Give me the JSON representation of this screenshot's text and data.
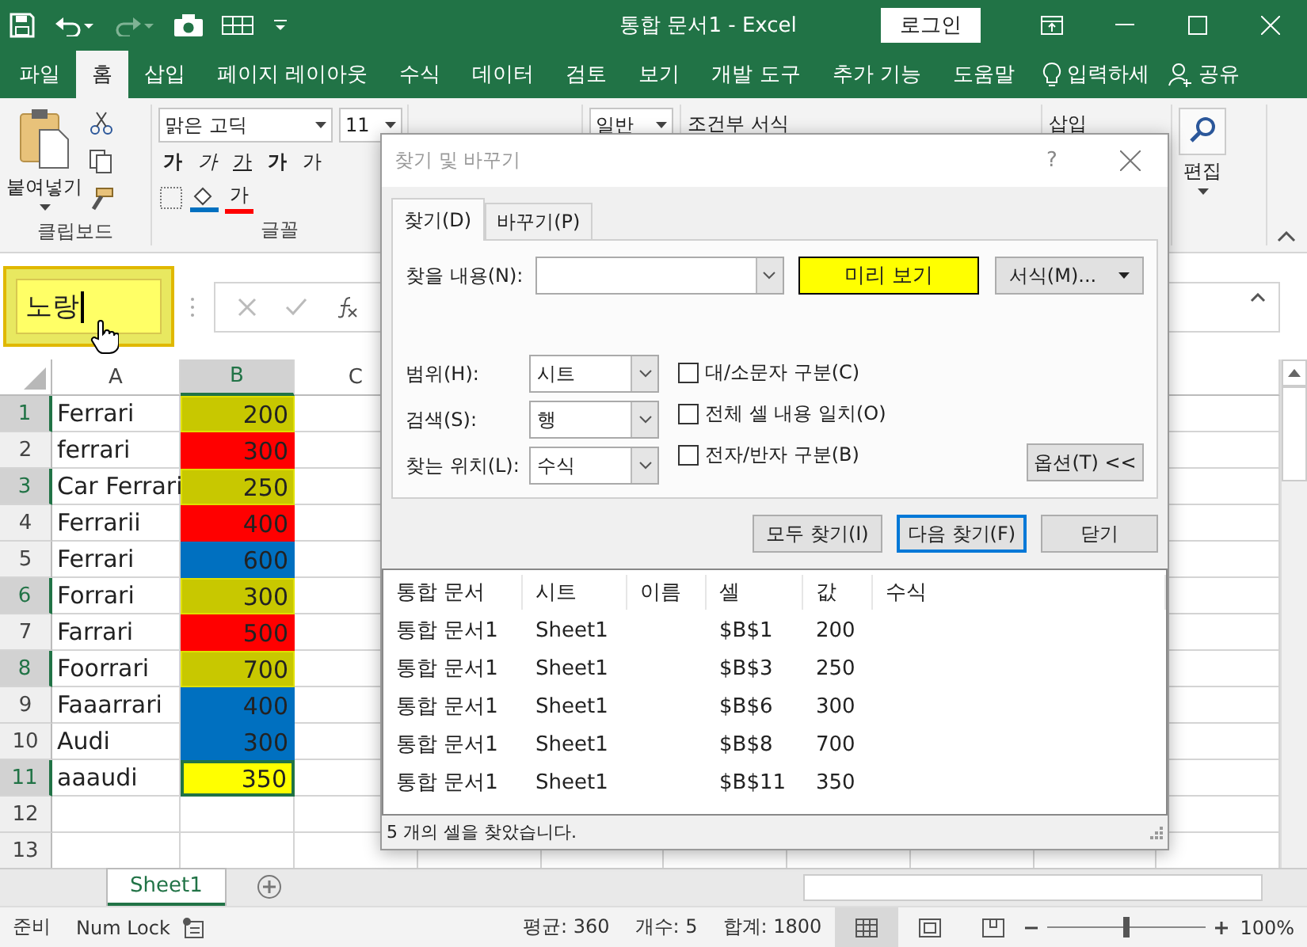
{
  "title_bar": {
    "title": "통합 문서1  -  Excel",
    "login": "로그인"
  },
  "ribbon_tabs": [
    {
      "label": "파일",
      "selected": false
    },
    {
      "label": "홈",
      "selected": true
    },
    {
      "label": "삽입",
      "selected": false
    },
    {
      "label": "페이지 레이아웃",
      "selected": false
    },
    {
      "label": "수식",
      "selected": false
    },
    {
      "label": "데이터",
      "selected": false
    },
    {
      "label": "검토",
      "selected": false
    },
    {
      "label": "보기",
      "selected": false
    },
    {
      "label": "개발 도구",
      "selected": false
    },
    {
      "label": "추가 기능",
      "selected": false
    },
    {
      "label": "도움말",
      "selected": false
    }
  ],
  "tell_me": "입력하세",
  "share": "공유",
  "ribbon": {
    "paste": "붙여넣기",
    "clipboard_group": "클립보드",
    "font_name": "맑은 고딕",
    "font_size": "11",
    "bold": "가",
    "italic": "가",
    "underline": "가",
    "grow": "가",
    "shrink": "가",
    "font_color": "가",
    "font_group": "글꼴",
    "number_format": "일반",
    "conditional_format": "조건부 서식",
    "insert": "삽입",
    "editing": "편집"
  },
  "name_box": {
    "value": "노랑",
    "highlighted": true
  },
  "columns": [
    {
      "label": "A",
      "selected": false
    },
    {
      "label": "B",
      "selected": true
    },
    {
      "label": "C",
      "selected": false
    }
  ],
  "rows": [
    {
      "number": "1",
      "name": "Ferrari",
      "value": "200",
      "color": "#c8c800",
      "selected": true,
      "active": false
    },
    {
      "number": "2",
      "name": "ferrari",
      "value": "300",
      "color": "#ff0000",
      "selected": false,
      "active": false
    },
    {
      "number": "3",
      "name": "Car Ferrari",
      "value": "250",
      "color": "#c8c800",
      "selected": true,
      "active": false
    },
    {
      "number": "4",
      "name": "Ferrarii",
      "value": "400",
      "color": "#ff0000",
      "selected": false,
      "active": false
    },
    {
      "number": "5",
      "name": "Ferrari",
      "value": "600",
      "color": "#0070c0",
      "selected": false,
      "active": false
    },
    {
      "number": "6",
      "name": "Forrari",
      "value": "300",
      "color": "#c8c800",
      "selected": true,
      "active": false
    },
    {
      "number": "7",
      "name": "Farrari",
      "value": "500",
      "color": "#ff0000",
      "selected": false,
      "active": false
    },
    {
      "number": "8",
      "name": "Foorrari",
      "value": "700",
      "color": "#c8c800",
      "selected": true,
      "active": false
    },
    {
      "number": "9",
      "name": "Faaarrari",
      "value": "400",
      "color": "#0070c0",
      "selected": false,
      "active": false
    },
    {
      "number": "10",
      "name": "Audi",
      "value": "300",
      "color": "#0070c0",
      "selected": false,
      "active": false
    },
    {
      "number": "11",
      "name": "aaaudi",
      "value": "350",
      "color": "#ffff00",
      "selected": true,
      "active": true
    },
    {
      "number": "12"
    },
    {
      "number": "13"
    }
  ],
  "sheet_tabs": [
    {
      "label": "Sheet1",
      "selected": true
    }
  ],
  "status_bar": {
    "ready": "준비",
    "num_lock": "Num Lock",
    "average": "평균: 360",
    "count": "개수: 5",
    "sum": "합계: 1800",
    "zoom": "100%",
    "level": 0.5
  },
  "dialog": {
    "title": "찾기 및 바꾸기",
    "help": "?",
    "tabs": [
      {
        "label": "찾기(D)",
        "selected": true
      },
      {
        "label": "바꾸기(P)",
        "selected": false
      }
    ],
    "find_label": "찾을 내용(N):",
    "preview": "미리 보기",
    "format_button": "서식(M)...",
    "options": [
      {
        "label": "범위(H):",
        "value": "시트"
      },
      {
        "label": "검색(S):",
        "value": "행"
      },
      {
        "label": "찾는 위치(L):",
        "value": "수식"
      }
    ],
    "checkboxes": [
      {
        "label": "대/소문자 구분(C)",
        "checked": false
      },
      {
        "label": "전체 셀 내용 일치(O)",
        "checked": false
      },
      {
        "label": "전자/반자 구분(B)",
        "checked": false
      }
    ],
    "options_button": "옵션(T) <<",
    "buttons": [
      {
        "label": "모두 찾기(I)",
        "selected": false
      },
      {
        "label": "다음 찾기(F)",
        "selected": true
      },
      {
        "label": "닫기",
        "selected": false
      }
    ],
    "results": {
      "columns": [
        "통합 문서",
        "시트",
        "이름",
        "셀",
        "값",
        "수식"
      ],
      "rows": [
        [
          "통합 문서1",
          "Sheet1",
          "",
          "$B$1",
          "200",
          ""
        ],
        [
          "통합 문서1",
          "Sheet1",
          "",
          "$B$3",
          "250",
          ""
        ],
        [
          "통합 문서1",
          "Sheet1",
          "",
          "$B$6",
          "300",
          ""
        ],
        [
          "통합 문서1",
          "Sheet1",
          "",
          "$B$8",
          "700",
          ""
        ],
        [
          "통합 문서1",
          "Sheet1",
          "",
          "$B$11",
          "350",
          ""
        ]
      ]
    },
    "status": "5 개의 셀을 찾았습니다."
  }
}
